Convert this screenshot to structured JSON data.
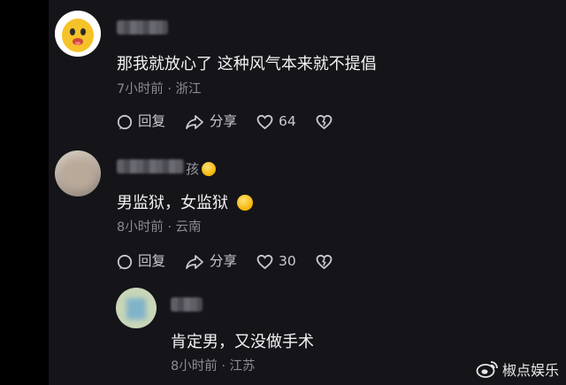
{
  "comments": [
    {
      "text": "那我就放心了 这种风气本来就不提倡",
      "meta": "7小时前 · 浙江",
      "reply_label": "回复",
      "share_label": "分享",
      "likes": "64"
    },
    {
      "name_suffix": "孩",
      "text": "男监狱，女监狱",
      "meta": "8小时前 · 云南",
      "reply_label": "回复",
      "share_label": "分享",
      "likes": "30"
    },
    {
      "text": "肯定男，又没做手术",
      "meta": "8小时前 · 江苏"
    }
  ],
  "watermark": {
    "text": "椒点娱乐"
  },
  "icons": {
    "reply": "comment-bubble-icon",
    "share": "share-arrow-icon",
    "like": "heart-icon",
    "dislike": "broken-heart-icon"
  }
}
